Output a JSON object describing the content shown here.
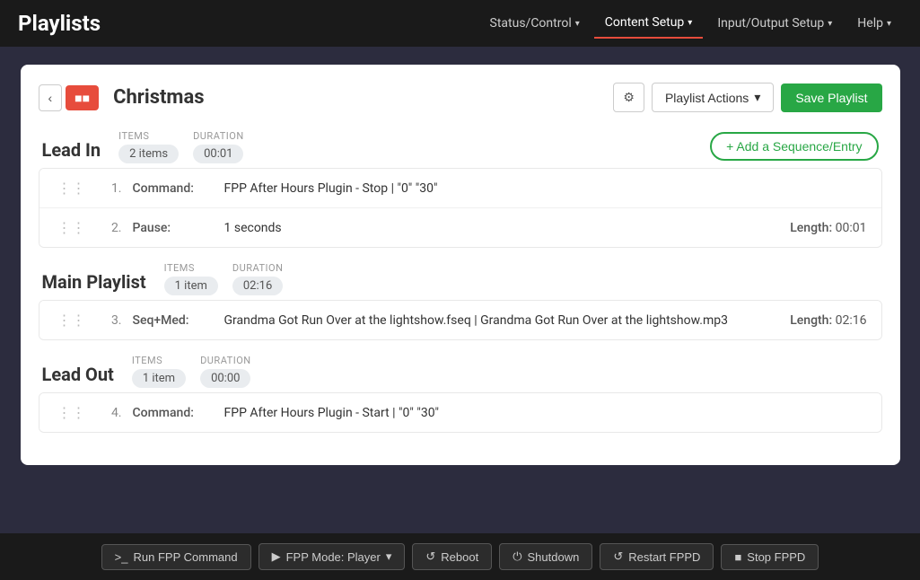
{
  "navbar": {
    "brand": "Playlists",
    "items": [
      {
        "label": "Status/Control",
        "hasDropdown": true,
        "active": false
      },
      {
        "label": "Content Setup",
        "hasDropdown": true,
        "active": true
      },
      {
        "label": "Input/Output Setup",
        "hasDropdown": true,
        "active": false
      },
      {
        "label": "Help",
        "hasDropdown": true,
        "active": false
      }
    ]
  },
  "playlist": {
    "title": "Christmas",
    "buttons": {
      "gear": "⚙",
      "playlist_actions": "Playlist Actions",
      "save": "Save Playlist"
    }
  },
  "sections": [
    {
      "id": "lead-in",
      "title": "Lead In",
      "items_label": "ITEMS",
      "items_value": "2 items",
      "duration_label": "DURATION",
      "duration_value": "00:01",
      "show_add": true,
      "add_label": "+ Add a Sequence/Entry",
      "rows": [
        {
          "num": "1.",
          "type": "Command:",
          "content": "FPP After Hours Plugin - Stop | \"0\" \"30\"",
          "has_length": false,
          "length": ""
        },
        {
          "num": "2.",
          "type": "Pause:",
          "content": "1 seconds",
          "has_length": true,
          "length": "Length: 00:01"
        }
      ]
    },
    {
      "id": "main-playlist",
      "title": "Main Playlist",
      "items_label": "ITEMS",
      "items_value": "1 item",
      "duration_label": "DURATION",
      "duration_value": "02:16",
      "show_add": false,
      "add_label": "",
      "rows": [
        {
          "num": "3.",
          "type": "Seq+Med:",
          "content": "Grandma Got Run Over at the lightshow.fseq | Grandma Got Run Over at the lightshow.mp3",
          "has_length": true,
          "length": "Length: 02:16"
        }
      ]
    },
    {
      "id": "lead-out",
      "title": "Lead Out",
      "items_label": "ITEMS",
      "items_value": "1 item",
      "duration_label": "DURATION",
      "duration_value": "00:00",
      "show_add": false,
      "add_label": "",
      "rows": [
        {
          "num": "4.",
          "type": "Command:",
          "content": "FPP After Hours Plugin - Start | \"0\" \"30\"",
          "has_length": false,
          "length": ""
        }
      ]
    }
  ],
  "bottom_bar": {
    "buttons": [
      {
        "id": "run-fpp",
        "icon": ">_",
        "label": "Run FPP Command"
      },
      {
        "id": "fpp-mode",
        "icon": "▶",
        "label": "FPP Mode: Player",
        "hasDropdown": true
      },
      {
        "id": "reboot",
        "icon": "↺",
        "label": "Reboot"
      },
      {
        "id": "shutdown",
        "icon": "⏻",
        "label": "Shutdown"
      },
      {
        "id": "restart-fppd",
        "icon": "↺",
        "label": "Restart FPPD"
      },
      {
        "id": "stop-fppd",
        "icon": "■",
        "label": "Stop FPPD"
      }
    ]
  }
}
